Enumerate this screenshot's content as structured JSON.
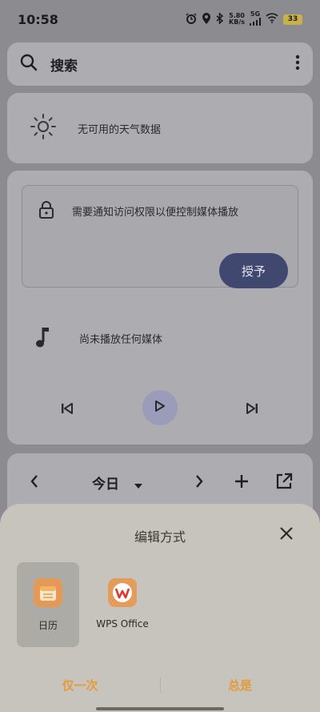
{
  "status_bar": {
    "time": "10:58",
    "net_speed_value": "5.80",
    "net_speed_unit": "KB/s",
    "network_type": "5G",
    "battery": "33"
  },
  "search": {
    "label": "搜索"
  },
  "weather": {
    "text": "无可用的天气数据"
  },
  "media": {
    "permission_text": "需要通知访问权限以便控制媒体播放",
    "grant_label": "授予",
    "no_media_text": "尚未播放任何媒体"
  },
  "calendar": {
    "title": "今日"
  },
  "sheet": {
    "title": "编辑方式",
    "apps": [
      {
        "label": "日历"
      },
      {
        "label": "WPS Office"
      }
    ],
    "once_label": "仅一次",
    "always_label": "总是"
  },
  "colors": {
    "accent_orange": "#e79a3b",
    "grant_button": "#414870",
    "sheet_background": "#c6c4bd"
  }
}
